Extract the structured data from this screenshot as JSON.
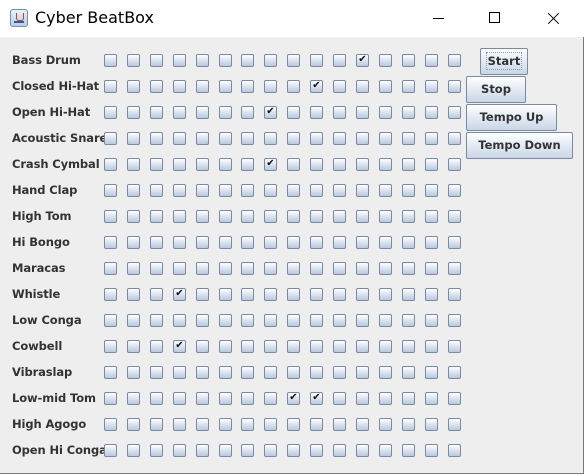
{
  "window": {
    "title": "Cyber BeatBox",
    "icon": "java-cup-icon",
    "controls": [
      "minimize-icon",
      "maximize-icon",
      "close-icon"
    ]
  },
  "beat_grid": {
    "columns": 16,
    "check_mark": "✔",
    "instruments": [
      {
        "label": "Bass Drum",
        "checked": [
          11
        ]
      },
      {
        "label": "Closed Hi-Hat",
        "checked": [
          9
        ]
      },
      {
        "label": "Open Hi-Hat",
        "checked": [
          7
        ]
      },
      {
        "label": "Acoustic Snare",
        "checked": []
      },
      {
        "label": "Crash Cymbal",
        "checked": [
          7
        ]
      },
      {
        "label": "Hand Clap",
        "checked": []
      },
      {
        "label": "High Tom",
        "checked": []
      },
      {
        "label": "Hi Bongo",
        "checked": []
      },
      {
        "label": "Maracas",
        "checked": []
      },
      {
        "label": "Whistle",
        "checked": [
          3
        ]
      },
      {
        "label": "Low Conga",
        "checked": []
      },
      {
        "label": "Cowbell",
        "checked": [
          3
        ]
      },
      {
        "label": "Vibraslap",
        "checked": []
      },
      {
        "label": "Low-mid Tom",
        "checked": [
          8,
          9
        ]
      },
      {
        "label": "High Agogo",
        "checked": []
      },
      {
        "label": "Open Hi Conga",
        "checked": []
      }
    ]
  },
  "controls": {
    "start_label": "Start",
    "stop_label": "Stop",
    "tempo_up_label": "Tempo Up",
    "tempo_down_label": "Tempo Down"
  }
}
